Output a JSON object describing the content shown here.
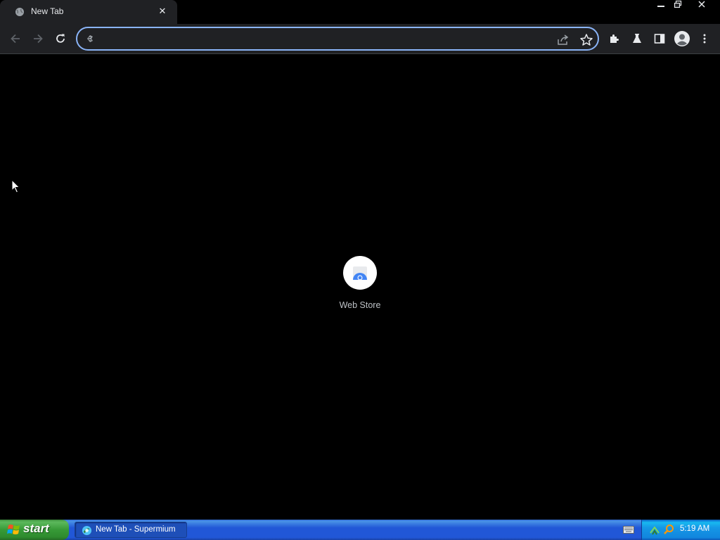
{
  "window": {
    "minimize_glyph": "–",
    "restore_glyph": "❐",
    "close_glyph": "✕"
  },
  "tab": {
    "title": "New Tab",
    "favicon": "globe-icon",
    "close_glyph": "✕"
  },
  "toolbar": {
    "back_icon": "back-arrow-icon",
    "forward_icon": "forward-arrow-icon",
    "reload_icon": "reload-icon",
    "omnibox": {
      "value": "",
      "placeholder": "",
      "leading_icon": "search-engine-icon",
      "accent_color": "#8ab4f8"
    },
    "share_icon": "share-icon",
    "bookmark_icon": "star-icon",
    "extensions_icon": "puzzle-icon",
    "labs_icon": "flask-icon",
    "side_panel_icon": "side-panel-icon",
    "profile_icon": "profile-avatar-icon",
    "menu_icon": "kebab-menu-icon"
  },
  "new_tab_page": {
    "shortcuts": [
      {
        "label": "Web Store",
        "icon": "web-store-icon"
      }
    ]
  },
  "taskbar": {
    "start_label": "start",
    "items": [
      {
        "label": "New Tab - Supermium",
        "icon": "supermium-icon",
        "active": true
      }
    ],
    "tray": {
      "clock": "5:19 AM",
      "icons": [
        "keyboard-icon",
        "network-icon",
        "search-icon"
      ]
    }
  }
}
